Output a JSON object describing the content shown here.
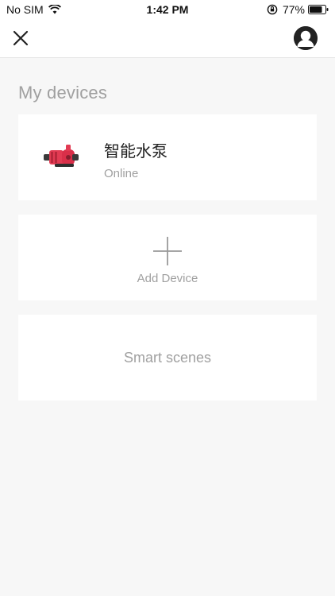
{
  "status_bar": {
    "carrier": "No SIM",
    "time": "1:42 PM",
    "battery_percent": "77%",
    "icons": [
      "wifi-icon",
      "orientation-lock-icon",
      "battery-icon"
    ]
  },
  "header": {
    "icons": [
      "close-icon",
      "user-avatar-icon"
    ]
  },
  "main": {
    "section_title": "My devices",
    "devices": [
      {
        "name": "智能水泵",
        "status": "Online",
        "icon": "water-pump-icon"
      }
    ],
    "add_device_label": "Add Device",
    "smart_scenes_label": "Smart scenes"
  },
  "colors": {
    "background": "#f7f7f7",
    "card": "#ffffff",
    "muted_text": "#a0a0a0",
    "primary_text": "#222222",
    "pump_red": "#e23b53"
  }
}
